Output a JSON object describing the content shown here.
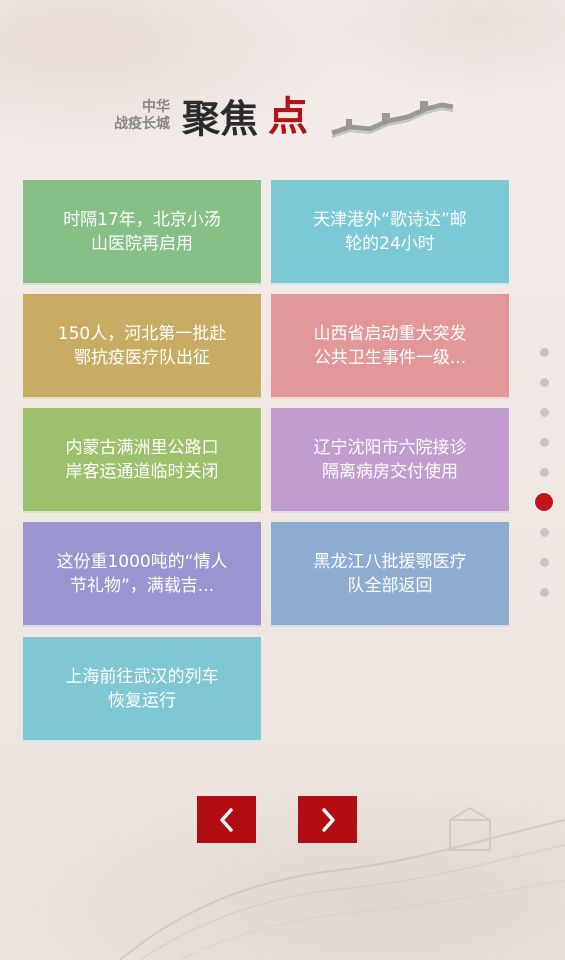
{
  "header": {
    "sub_brand_line1": "中华",
    "sub_brand_line2": "战疫长城",
    "title": "聚焦",
    "title_accent": "点"
  },
  "tiles": [
    {
      "line1": "时隔17年，北京小汤",
      "line2": "山医院再启用",
      "color": "#86c087"
    },
    {
      "line1": "天津港外“歌诗达”邮",
      "line2": "轮的24小时",
      "color": "#7bcad5"
    },
    {
      "line1": "150人，河北第一批赴",
      "line2": "鄂抗疫医疗队出征",
      "color": "#c9ac63"
    },
    {
      "line1": "山西省启动重大突发",
      "line2": "公共卫生事件一级...",
      "color": "#e29898"
    },
    {
      "line1": "内蒙古满洲里公路口",
      "line2": "岸客运通道临时关闭",
      "color": "#9cc06c"
    },
    {
      "line1": "辽宁沈阳市六院接诊",
      "line2": "隔离病房交付使用",
      "color": "#c09ccf"
    },
    {
      "line1": "这份重1000吨的“情人",
      "line2": "节礼物”，满载吉...",
      "color": "#9a95d0"
    },
    {
      "line1": "黑龙江八批援鄂医疗",
      "line2": "队全部返回",
      "color": "#8eadd0"
    },
    {
      "line1": "上海前往武汉的列车",
      "line2": "恢复运行",
      "color": "#7fc7d2"
    }
  ],
  "pager": {
    "dot_count": 9,
    "active_index": 5,
    "active_color": "#c3131c"
  },
  "nav": {
    "prev_icon": "chevron-left-icon",
    "next_icon": "chevron-right-icon",
    "button_color": "#b30d14"
  }
}
